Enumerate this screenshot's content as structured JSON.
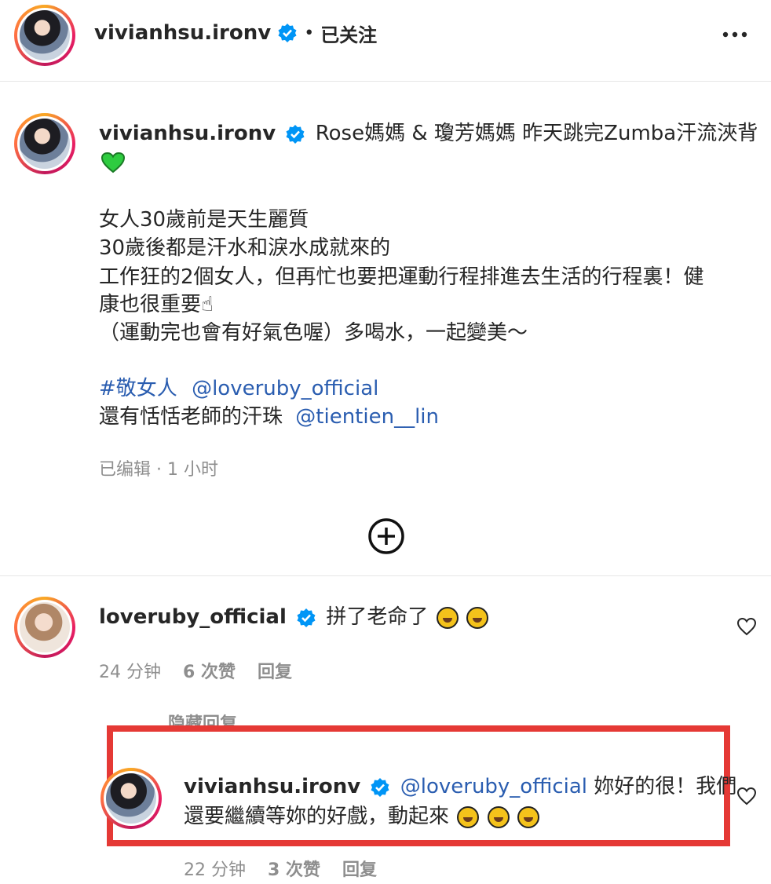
{
  "header": {
    "username": "vivianhsu.ironv",
    "separator": "•",
    "follow_status": "已关注",
    "more_icon": "more-horizontal-icon"
  },
  "post": {
    "username": "vivianhsu.ironv",
    "caption_first": "Rose媽媽 & 瓊芳媽媽 昨天跳完Zumba汗流浹背",
    "heart_emoji": "green-heart-icon",
    "lines": [
      "女人30歲前是天生麗質",
      "30歲後都是汗水和淚水成就來的",
      "工作狂的2個女人，但再忙也要把運動行程排進去生活的行程裏！健",
      "康也很重要☝",
      "（運動完也會有好氣色喔）多喝水，一起變美～"
    ],
    "hashtag": "#敬女人",
    "mention1": "@loveruby_official",
    "line_last_prefix": "還有恬恬老師的汗珠",
    "mention2": "@tientien__lin",
    "meta": "已编辑 · 1 小时"
  },
  "add_icon": "add-circle-icon",
  "comment1": {
    "username": "loveruby_official",
    "text": "拼了老命了",
    "time": "24 分钟",
    "likes": "6 次赞",
    "reply": "回复"
  },
  "hide_replies": "隐藏回复",
  "comment2": {
    "username": "vivianhsu.ironv",
    "mention": "@loveruby_official",
    "text_first": "妳好的很！我們",
    "text_second": "還要繼續等妳的好戲，動起來",
    "time": "22 分钟",
    "likes": "3 次赞",
    "reply": "回复"
  },
  "colors": {
    "highlight_box": "#e53935",
    "link": "#2a5db0",
    "verified": "#0095f6"
  }
}
